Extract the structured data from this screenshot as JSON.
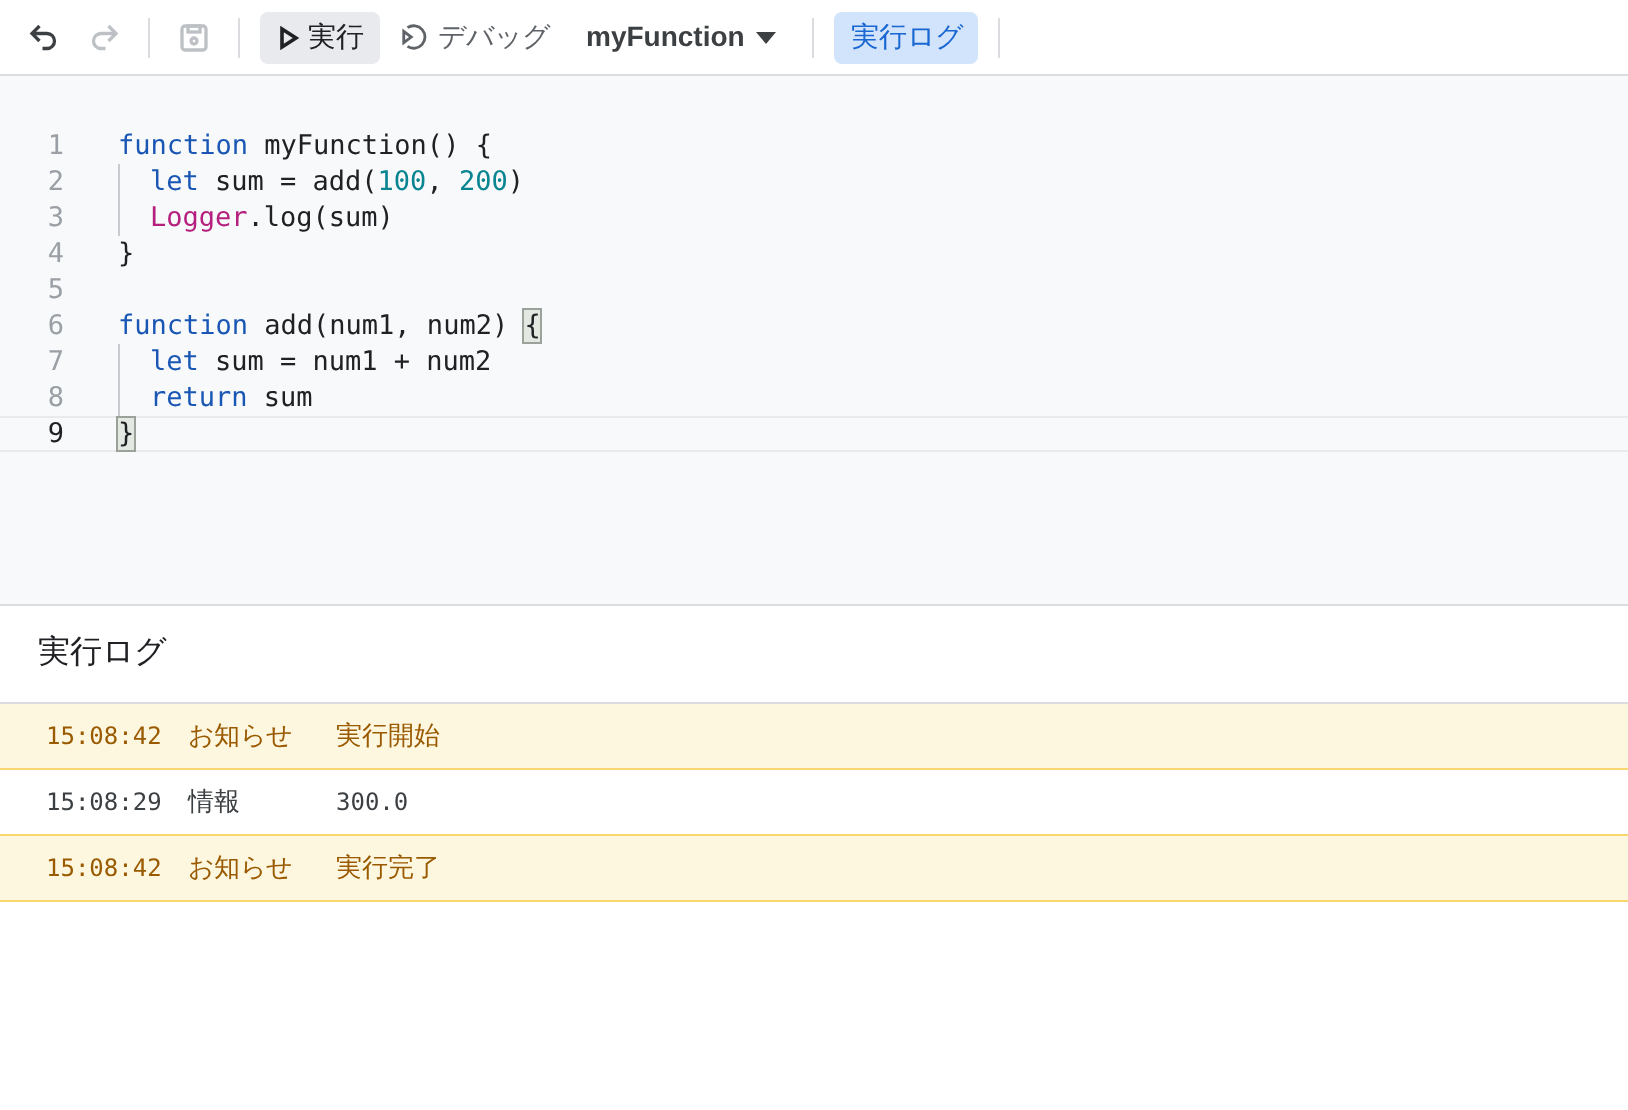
{
  "toolbar": {
    "undo": {
      "disabled": false
    },
    "redo": {
      "disabled": true
    },
    "save": {
      "disabled": true
    },
    "run": {
      "label": "実行",
      "selected": true
    },
    "debug": {
      "label": "デバッグ"
    },
    "function_select": {
      "value": "myFunction"
    },
    "log_toggle": {
      "label": "実行ログ",
      "selected": true
    }
  },
  "editor": {
    "lines": [
      {
        "number": "1",
        "active": false,
        "indented": false,
        "tokens": [
          {
            "kind": "kw",
            "text": "function"
          },
          {
            "kind": "plain",
            "text": " myFunction() {"
          }
        ]
      },
      {
        "number": "2",
        "active": false,
        "indented": true,
        "tokens": [
          {
            "kind": "kw",
            "text": "let"
          },
          {
            "kind": "plain",
            "text": " sum = add("
          },
          {
            "kind": "num",
            "text": "100"
          },
          {
            "kind": "plain",
            "text": ", "
          },
          {
            "kind": "num",
            "text": "200"
          },
          {
            "kind": "plain",
            "text": ")"
          }
        ]
      },
      {
        "number": "3",
        "active": false,
        "indented": true,
        "tokens": [
          {
            "kind": "obj",
            "text": "Logger"
          },
          {
            "kind": "plain",
            "text": ".log(sum)"
          }
        ]
      },
      {
        "number": "4",
        "active": false,
        "indented": false,
        "tokens": [
          {
            "kind": "plain",
            "text": "}"
          }
        ]
      },
      {
        "number": "5",
        "active": false,
        "indented": false
      },
      {
        "number": "6",
        "active": false,
        "indented": false,
        "tokens": [
          {
            "kind": "kw",
            "text": "function"
          },
          {
            "kind": "plain",
            "text": " add(num1, num2) "
          },
          {
            "kind": "match",
            "text": "{"
          }
        ]
      },
      {
        "number": "7",
        "active": false,
        "indented": true,
        "tokens": [
          {
            "kind": "kw",
            "text": "let"
          },
          {
            "kind": "plain",
            "text": " sum = num1 + num2"
          }
        ]
      },
      {
        "number": "8",
        "active": false,
        "indented": true,
        "tokens": [
          {
            "kind": "kw",
            "text": "return"
          },
          {
            "kind": "plain",
            "text": " sum"
          }
        ]
      },
      {
        "number": "9",
        "active": true,
        "indented": false,
        "tokens": [
          {
            "kind": "match",
            "text": "}"
          }
        ]
      }
    ]
  },
  "log": {
    "title": "実行ログ",
    "rows": [
      {
        "kind": "notice",
        "time": "15:08:42",
        "level": "お知らせ",
        "message": "実行開始"
      },
      {
        "kind": "info",
        "time": "15:08:29",
        "level": "情報",
        "message": "300.0"
      },
      {
        "kind": "notice",
        "time": "15:08:42",
        "level": "お知らせ",
        "message": "実行完了"
      }
    ]
  }
}
